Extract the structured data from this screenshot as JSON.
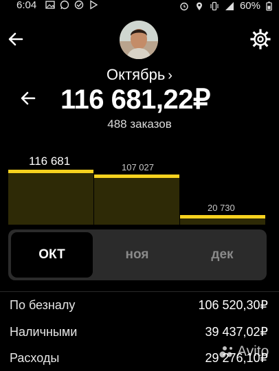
{
  "status_bar": {
    "time": "6:04",
    "battery": "60%",
    "icons": [
      "image-icon",
      "whatsapp-icon",
      "check-icon",
      "play-icon",
      "alarm-icon",
      "location-icon",
      "vibrate-icon",
      "signal-icon",
      "battery-icon"
    ]
  },
  "header": {
    "back_icon": "arrow-left-icon",
    "avatar": "user-avatar",
    "settings_icon": "gear-icon"
  },
  "summary": {
    "month": "Октябрь",
    "month_chevron": "›",
    "amount": "116 681,22₽",
    "orders": "488 заказов"
  },
  "colors": {
    "accent": "#f7d21f",
    "bar_fill": "#2e2a06",
    "segment_bg": "#2b2b2b"
  },
  "chart_data": {
    "type": "bar",
    "categories": [
      "окт",
      "ноя",
      "дек"
    ],
    "values": [
      116681,
      107027,
      20730
    ],
    "data_labels": [
      "116 681",
      "107 027",
      "20 730"
    ],
    "highlighted_index": 0,
    "ylim": [
      0,
      116681
    ]
  },
  "segments": [
    {
      "label": "ОКТ",
      "active": true
    },
    {
      "label": "ноя",
      "active": false
    },
    {
      "label": "дек",
      "active": false
    }
  ],
  "details": [
    {
      "label": "По безналу",
      "value": "106 520,30₽"
    },
    {
      "label": "Наличными",
      "value": "39 437,02₽"
    },
    {
      "label": "Расходы",
      "value": "29 276,10₽"
    }
  ],
  "watermark": "Avito"
}
